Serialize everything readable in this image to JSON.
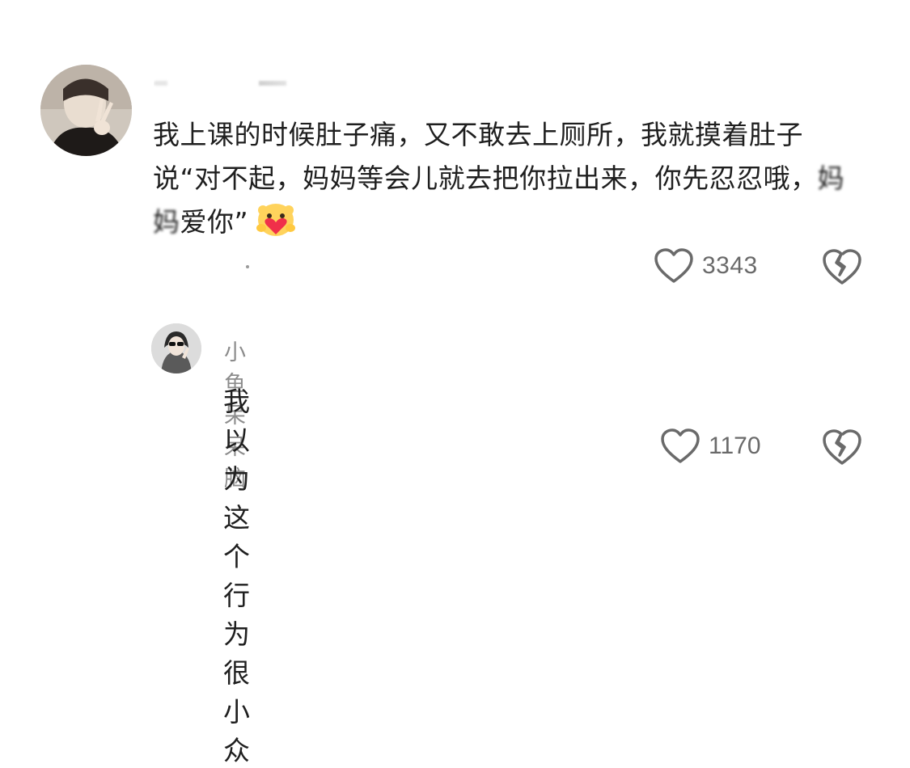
{
  "comment": {
    "text_before_blur": "我上课的时候肚子痛，又不敢去上厕所，我就摸着肚子说“对不起，妈妈等会儿就去把你拉出来，你先忍忍哦，",
    "text_blurred": "妈妈",
    "text_after_blur": "爱你”",
    "emoji": "heart-hug-emoji",
    "likes": "3343"
  },
  "reply": {
    "username": "小鱼呆呆脑",
    "text": "我以为这个行为很小众",
    "likes": "1170"
  },
  "colors": {
    "text": "#1f1f1f",
    "muted": "#8c8c8c",
    "icon": "#6a6a6a"
  }
}
